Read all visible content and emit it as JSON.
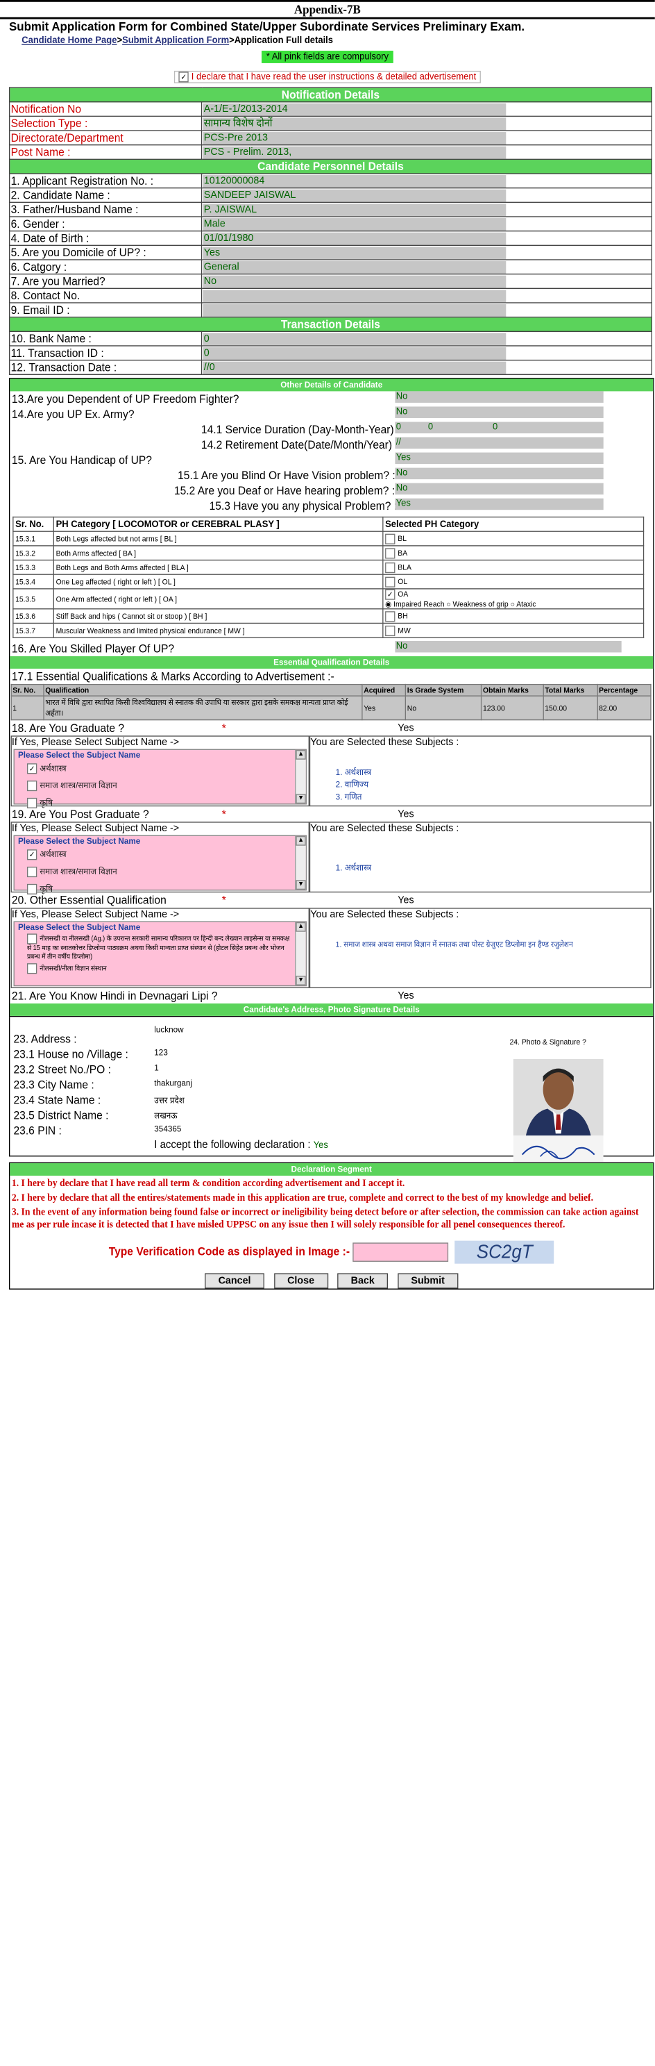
{
  "header": {
    "appendix": "Appendix-7B",
    "form_title": "Submit Application Form for Combined State/Upper Subordinate Services Preliminary Exam.",
    "breadcrumb": {
      "home": "Candidate Home Page",
      "sep1": ">",
      "submit": "Submit Application Form",
      "sep2": ">",
      "current": "Application Full details"
    },
    "compulsory_note": "* All pink fields are compulsory",
    "declare_text": "I declare that I have read the user instructions & detailed advertisement"
  },
  "notification": {
    "heading": "Notification Details",
    "rows": [
      {
        "label": "Notification No",
        "value": "A-1/E-1/2013-2014"
      },
      {
        "label": "Selection Type :",
        "value": "सामान्य विशेष दोनों"
      },
      {
        "label": "Directorate/Department",
        "value": "PCS-Pre 2013"
      },
      {
        "label": "Post Name :",
        "value": "PCS - Prelim. 2013,"
      }
    ]
  },
  "personnel": {
    "heading": "Candidate Personnel Details",
    "rows": [
      {
        "label": "1. Applicant Registration No. :",
        "value": "10120000084"
      },
      {
        "label": "2. Candidate Name :",
        "value": "SANDEEP JAISWAL"
      },
      {
        "label": "3. Father/Husband Name :",
        "value": "P. JAISWAL"
      },
      {
        "label": "6. Gender :",
        "value": "Male"
      },
      {
        "label": "4. Date of Birth :",
        "value": "01/01/1980"
      },
      {
        "label": "5. Are you Domicile of UP? :",
        "value": "Yes"
      },
      {
        "label": "6. Catgory :",
        "value": "General"
      },
      {
        "label": "7. Are you Married?",
        "value": "No"
      },
      {
        "label": "8. Contact No.",
        "value": ""
      },
      {
        "label": "9. Email ID :",
        "value": ""
      }
    ]
  },
  "transaction": {
    "heading": "Transaction Details",
    "rows": [
      {
        "label": "10. Bank Name :",
        "value": "0"
      },
      {
        "label": "11. Transaction ID :",
        "value": "0"
      },
      {
        "label": "12. Transaction Date :",
        "value": "//0"
      }
    ]
  },
  "other": {
    "heading": "Other Details of Candidate",
    "q13": {
      "label": "13.Are you Dependent of UP Freedom Fighter?",
      "value": "No"
    },
    "q14": {
      "label": "14.Are you UP Ex. Army?",
      "value": "No"
    },
    "q14_1": {
      "label": "14.1 Service Duration (Day-Month-Year)",
      "v1": "0",
      "v2": "0",
      "v3": "0"
    },
    "q14_2": {
      "label": "14.2 Retirement Date(Date/Month/Year)",
      "value": "//"
    },
    "q15": {
      "label": "15. Are You Handicap of UP?",
      "value": "Yes"
    },
    "q15_1": {
      "label": "15.1 Are you Blind Or Have Vision problem? :",
      "value": "No"
    },
    "q15_2": {
      "label": "15.2 Are you Deaf or Have hearing problem? :",
      "value": "No"
    },
    "q15_3": {
      "label": "15.3 Have you any physical Problem? :",
      "value": "Yes"
    },
    "ph_headers": [
      "Sr. No.",
      "PH Category [ LOCOMOTOR or CEREBRAL PLASY ]",
      "Selected PH Category"
    ],
    "ph_rows": [
      {
        "sr": "15.3.1",
        "cat": "Both Legs affected but not arms [ BL ]",
        "code": "BL"
      },
      {
        "sr": "15.3.2",
        "cat": "Both Arms affected [ BA ]",
        "code": "BA"
      },
      {
        "sr": "15.3.3",
        "cat": "Both Legs and Both Arms affected [ BLA ]",
        "code": "BLA"
      },
      {
        "sr": "15.3.4",
        "cat": "One Leg affected ( right or left ) [ OL ]",
        "code": "OL"
      },
      {
        "sr": "15.3.5",
        "cat": "One Arm affected ( right or left ) [ OA ]",
        "code": "OA"
      },
      {
        "sr": "15.3.6",
        "cat": "Stiff Back and hips ( Cannot sit or stoop ) [ BH ]",
        "code": "BH"
      },
      {
        "sr": "15.3.7",
        "cat": "Muscular Weakness and limited physical endurance [ MW ]",
        "code": "MW"
      }
    ],
    "oa_options": [
      "Impaired Reach",
      "Weakness of grip",
      "Ataxic"
    ],
    "q16": {
      "label": "16. Are You Skilled Player Of UP?",
      "value": "No"
    }
  },
  "qualification": {
    "heading": "Essential Qualification Details",
    "title": "17.1 Essential Qualifications & Marks According to Advertisement :-",
    "headers": [
      "Sr. No.",
      "Qualification",
      "Acquired",
      "Is Grade System",
      "Obtain Marks",
      "Total Marks",
      "Percentage"
    ],
    "rows": [
      {
        "sr": "1",
        "q": "भारत में विधि द्वारा स्थापित किसी विश्वविद्यालय से स्नातक की उपाधि या सरकार द्वारा इसके समकक्ष मान्यता प्राप्त कोई अर्हता।",
        "acq": "Yes",
        "grade": "No",
        "obt": "123.00",
        "tot": "150.00",
        "pct": "82.00"
      }
    ],
    "q18": {
      "label": "18. Are You Graduate ?",
      "value": "Yes"
    },
    "q19": {
      "label": "19. Are You Post Graduate ?",
      "value": "Yes"
    },
    "q20": {
      "label": "20. Other Essential Qualification",
      "value": "Yes"
    },
    "q21": {
      "label": "21. Are You Know Hindi in Devnagari Lipi ?",
      "value": "Yes"
    },
    "req": "*",
    "left_title": "If Yes, Please Select Subject Name ->",
    "right_title": "You are Selected these Subjects :",
    "legend": "Please Select the Subject Name",
    "grad_list": [
      "अर्थशास्त्र",
      "समाज शास्त्र/समाज विज्ञान",
      "कृषि"
    ],
    "grad_selected": [
      "1. अर्थशास्त्र",
      "2. वाणिज्य",
      "3. गणित"
    ],
    "pg_list": [
      "अर्थशास्त्र",
      "समाज शास्त्र/समाज विज्ञान",
      "कृषि"
    ],
    "pg_selected": [
      "1. अर्थशास्त्र"
    ],
    "other_list": [
      "नीलसखी या नीलसखी (Ag.) के उपरान्त सरकारी सामान्य परिकारण पर हिन्दी बन्द लेख्यान लाइसेन्स या समकक्ष से 15 माह का स्नातकोत्तर डिप्लोमा पाठ्यक्रम अथवा किसी मान्यता प्राप्त संस्थान से (होटल सिहेत प्रबन्ध और भोजन प्रबन्ध में तीन वर्षीय डिप्लोमा)",
      "नीलसखी/नीला विज्ञान संस्थान"
    ],
    "other_selected": [
      "1. समाज शास्त्र अथवा समाज विज्ञान में स्नातक तथा पोस्ट ग्रेजुएट डिप्लोमा इन हैण्ड रजुलेशन"
    ]
  },
  "address": {
    "heading": "Candidate's Address, Photo Signature Details",
    "rows": [
      {
        "label": "23. Address :",
        "value": "lucknow"
      },
      {
        "label": "23.1 House no /Village :",
        "value": "123"
      },
      {
        "label": "23.2 Street No./PO :",
        "value": "1"
      },
      {
        "label": "23.3 City Name :",
        "value": "thakurganj"
      },
      {
        "label": "23.4 State Name :",
        "value": "उत्तर प्रदेश"
      },
      {
        "label": "23.5 District Name :",
        "value": "लखनऊ"
      },
      {
        "label": "23.6 PIN :",
        "value": "354365"
      }
    ],
    "photo_label": "24. Photo & Signature ?",
    "accept_label": "I accept the following declaration :",
    "accept_value": "Yes"
  },
  "declaration": {
    "heading": "Declaration Segment",
    "items": [
      "1. I here by declare that I have read all term & condition according advertisement and I accept it.",
      "2. I here by declare that all the entires/statements made in this application are true, complete and correct to the best of my knowledge and belief.",
      "3. In the event of any information being found false or incorrect or ineligibility being detect before or after selection, the commission can take action against me as per rule incase it is detected that I have misled UPPSC on any issue then I will solely responsible for all penel consequences thereof."
    ],
    "verify_label": "Type Verification Code as displayed in Image :-",
    "captcha": "SC2gT"
  },
  "buttons": {
    "cancel": "Cancel",
    "close": "Close",
    "back": "Back",
    "submit": "Submit"
  },
  "colors": {
    "section_green": "#5bd35b",
    "value_grey": "#c6c6c6",
    "pink": "#ffc0d8",
    "label_red": "#cc0000"
  }
}
